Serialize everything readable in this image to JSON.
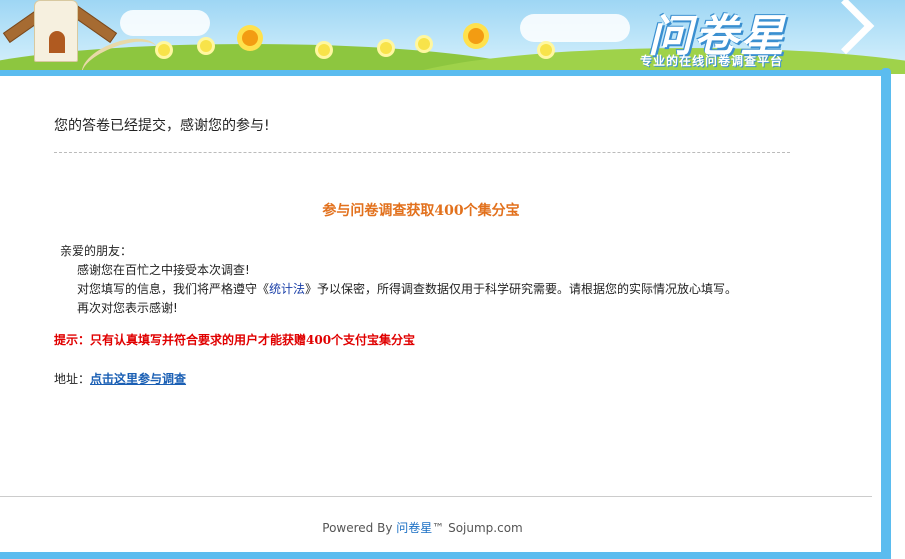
{
  "header": {
    "logo_text": "问卷星",
    "logo_tagline": "专业的在线问卷调查平台"
  },
  "main": {
    "submitted_message": "您的答卷已经提交，感谢您的参与!",
    "promo_title": "参与问卷调查获取400个集分宝",
    "greeting": "亲爱的朋友：",
    "line1": "感谢您在百忙之中接受本次调查!",
    "line2_prefix": "对您填写的信息，我们将严格遵守《",
    "law_link": "统计法",
    "line2_suffix": "》予以保密，所得调查数据仅用于科学研究需要。请根据您的实际情况放心填写。",
    "line3": "再次对您表示感谢!",
    "tip": "提示：只有认真填写并符合要求的用户才能获赠400个支付宝集分宝",
    "address_label": "地址：",
    "address_link": "点击这里参与调查"
  },
  "footer": {
    "powered_prefix": "Powered By ",
    "brand": "问卷星",
    "powered_suffix": "™ Sojump.com"
  },
  "colors": {
    "frame": "#5bbcef",
    "promo_title": "#e2711d",
    "tip": "#e00000",
    "link": "#1a5fb4"
  }
}
